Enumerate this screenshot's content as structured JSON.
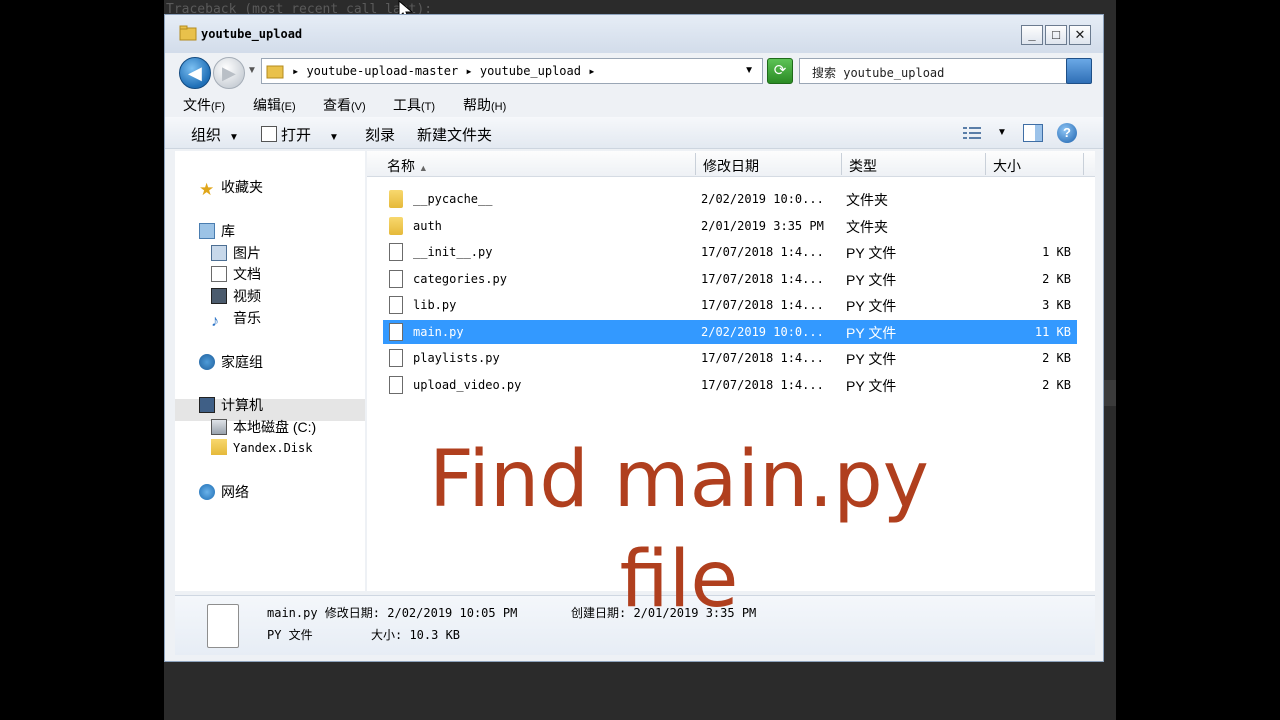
{
  "console": {
    "text": "Traceback (most recent call last):"
  },
  "window": {
    "title": "youtube_upload",
    "min_label": "_",
    "max_label": "□",
    "close_label": "✕"
  },
  "address": {
    "crumb": "▸ youtube-upload-master ▸ youtube_upload ▸",
    "search_placeholder": "搜索 youtube_upload"
  },
  "menu": [
    {
      "label": "文件",
      "acc": "(F)"
    },
    {
      "label": "编辑",
      "acc": "(E)"
    },
    {
      "label": "查看",
      "acc": "(V)"
    },
    {
      "label": "工具",
      "acc": "(T)"
    },
    {
      "label": "帮助",
      "acc": "(H)"
    }
  ],
  "toolbar": {
    "organize": "组织",
    "open": "打开",
    "burn": "刻录",
    "new_folder": "新建文件夹"
  },
  "nav": {
    "favorites": "收藏夹",
    "libraries": "库",
    "pictures": "图片",
    "documents": "文档",
    "videos": "视频",
    "music": "音乐",
    "homegroup": "家庭组",
    "computer": "计算机",
    "local_disk": "本地磁盘 (C:)",
    "yandex": "Yandex.Disk",
    "network": "网络"
  },
  "columns": {
    "name": "名称",
    "modified": "修改日期",
    "type": "类型",
    "size": "大小"
  },
  "files": [
    {
      "name": "__pycache__",
      "date": "2/02/2019 10:0...",
      "type": "文件夹",
      "size": "",
      "kind": "folder"
    },
    {
      "name": "auth",
      "date": "2/01/2019 3:35 PM",
      "type": "文件夹",
      "size": "",
      "kind": "folder"
    },
    {
      "name": "__init__.py",
      "date": "17/07/2018 1:4...",
      "type": "PY 文件",
      "size": "1 KB",
      "kind": "file"
    },
    {
      "name": "categories.py",
      "date": "17/07/2018 1:4...",
      "type": "PY 文件",
      "size": "2 KB",
      "kind": "file"
    },
    {
      "name": "lib.py",
      "date": "17/07/2018 1:4...",
      "type": "PY 文件",
      "size": "3 KB",
      "kind": "file"
    },
    {
      "name": "main.py",
      "date": "2/02/2019 10:0...",
      "type": "PY 文件",
      "size": "11 KB",
      "kind": "file",
      "selected": true
    },
    {
      "name": "playlists.py",
      "date": "17/07/2018 1:4...",
      "type": "PY 文件",
      "size": "2 KB",
      "kind": "file"
    },
    {
      "name": "upload_video.py",
      "date": "17/07/2018 1:4...",
      "type": "PY 文件",
      "size": "2 KB",
      "kind": "file"
    }
  ],
  "overlay": {
    "line1": "Find main.py",
    "line2": "file"
  },
  "details": {
    "line1": "main.py 修改日期: 2/02/2019 10:05 PM",
    "created": "创建日期: 2/01/2019 3:35 PM",
    "type": "PY 文件",
    "size": "大小: 10.3 KB"
  },
  "colors": {
    "selection": "#3399ff",
    "overlay_text": "#b03f1e"
  }
}
